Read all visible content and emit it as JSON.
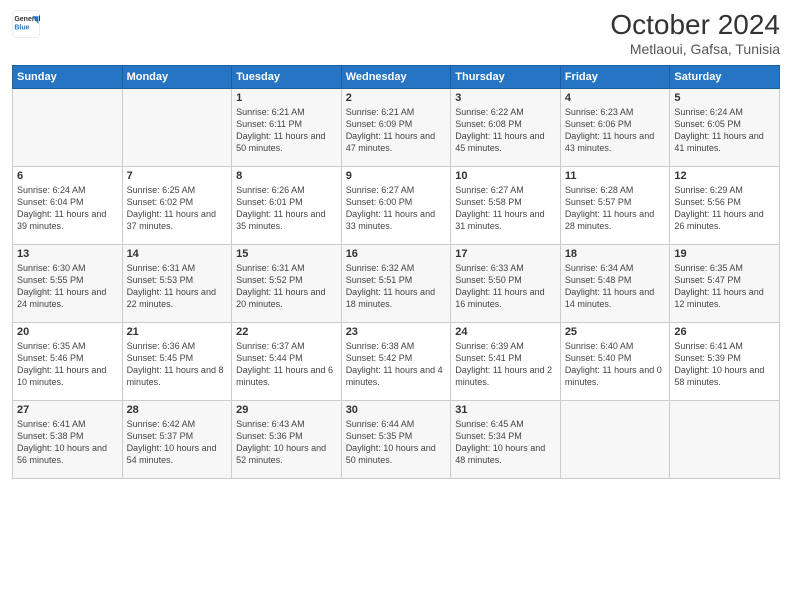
{
  "header": {
    "logo_line1": "General",
    "logo_line2": "Blue",
    "month": "October 2024",
    "location": "Metlaoui, Gafsa, Tunisia"
  },
  "days_of_week": [
    "Sunday",
    "Monday",
    "Tuesday",
    "Wednesday",
    "Thursday",
    "Friday",
    "Saturday"
  ],
  "weeks": [
    [
      {
        "day": "",
        "info": ""
      },
      {
        "day": "",
        "info": ""
      },
      {
        "day": "1",
        "info": "Sunrise: 6:21 AM\nSunset: 6:11 PM\nDaylight: 11 hours and 50 minutes."
      },
      {
        "day": "2",
        "info": "Sunrise: 6:21 AM\nSunset: 6:09 PM\nDaylight: 11 hours and 47 minutes."
      },
      {
        "day": "3",
        "info": "Sunrise: 6:22 AM\nSunset: 6:08 PM\nDaylight: 11 hours and 45 minutes."
      },
      {
        "day": "4",
        "info": "Sunrise: 6:23 AM\nSunset: 6:06 PM\nDaylight: 11 hours and 43 minutes."
      },
      {
        "day": "5",
        "info": "Sunrise: 6:24 AM\nSunset: 6:05 PM\nDaylight: 11 hours and 41 minutes."
      }
    ],
    [
      {
        "day": "6",
        "info": "Sunrise: 6:24 AM\nSunset: 6:04 PM\nDaylight: 11 hours and 39 minutes."
      },
      {
        "day": "7",
        "info": "Sunrise: 6:25 AM\nSunset: 6:02 PM\nDaylight: 11 hours and 37 minutes."
      },
      {
        "day": "8",
        "info": "Sunrise: 6:26 AM\nSunset: 6:01 PM\nDaylight: 11 hours and 35 minutes."
      },
      {
        "day": "9",
        "info": "Sunrise: 6:27 AM\nSunset: 6:00 PM\nDaylight: 11 hours and 33 minutes."
      },
      {
        "day": "10",
        "info": "Sunrise: 6:27 AM\nSunset: 5:58 PM\nDaylight: 11 hours and 31 minutes."
      },
      {
        "day": "11",
        "info": "Sunrise: 6:28 AM\nSunset: 5:57 PM\nDaylight: 11 hours and 28 minutes."
      },
      {
        "day": "12",
        "info": "Sunrise: 6:29 AM\nSunset: 5:56 PM\nDaylight: 11 hours and 26 minutes."
      }
    ],
    [
      {
        "day": "13",
        "info": "Sunrise: 6:30 AM\nSunset: 5:55 PM\nDaylight: 11 hours and 24 minutes."
      },
      {
        "day": "14",
        "info": "Sunrise: 6:31 AM\nSunset: 5:53 PM\nDaylight: 11 hours and 22 minutes."
      },
      {
        "day": "15",
        "info": "Sunrise: 6:31 AM\nSunset: 5:52 PM\nDaylight: 11 hours and 20 minutes."
      },
      {
        "day": "16",
        "info": "Sunrise: 6:32 AM\nSunset: 5:51 PM\nDaylight: 11 hours and 18 minutes."
      },
      {
        "day": "17",
        "info": "Sunrise: 6:33 AM\nSunset: 5:50 PM\nDaylight: 11 hours and 16 minutes."
      },
      {
        "day": "18",
        "info": "Sunrise: 6:34 AM\nSunset: 5:48 PM\nDaylight: 11 hours and 14 minutes."
      },
      {
        "day": "19",
        "info": "Sunrise: 6:35 AM\nSunset: 5:47 PM\nDaylight: 11 hours and 12 minutes."
      }
    ],
    [
      {
        "day": "20",
        "info": "Sunrise: 6:35 AM\nSunset: 5:46 PM\nDaylight: 11 hours and 10 minutes."
      },
      {
        "day": "21",
        "info": "Sunrise: 6:36 AM\nSunset: 5:45 PM\nDaylight: 11 hours and 8 minutes."
      },
      {
        "day": "22",
        "info": "Sunrise: 6:37 AM\nSunset: 5:44 PM\nDaylight: 11 hours and 6 minutes."
      },
      {
        "day": "23",
        "info": "Sunrise: 6:38 AM\nSunset: 5:42 PM\nDaylight: 11 hours and 4 minutes."
      },
      {
        "day": "24",
        "info": "Sunrise: 6:39 AM\nSunset: 5:41 PM\nDaylight: 11 hours and 2 minutes."
      },
      {
        "day": "25",
        "info": "Sunrise: 6:40 AM\nSunset: 5:40 PM\nDaylight: 11 hours and 0 minutes."
      },
      {
        "day": "26",
        "info": "Sunrise: 6:41 AM\nSunset: 5:39 PM\nDaylight: 10 hours and 58 minutes."
      }
    ],
    [
      {
        "day": "27",
        "info": "Sunrise: 6:41 AM\nSunset: 5:38 PM\nDaylight: 10 hours and 56 minutes."
      },
      {
        "day": "28",
        "info": "Sunrise: 6:42 AM\nSunset: 5:37 PM\nDaylight: 10 hours and 54 minutes."
      },
      {
        "day": "29",
        "info": "Sunrise: 6:43 AM\nSunset: 5:36 PM\nDaylight: 10 hours and 52 minutes."
      },
      {
        "day": "30",
        "info": "Sunrise: 6:44 AM\nSunset: 5:35 PM\nDaylight: 10 hours and 50 minutes."
      },
      {
        "day": "31",
        "info": "Sunrise: 6:45 AM\nSunset: 5:34 PM\nDaylight: 10 hours and 48 minutes."
      },
      {
        "day": "",
        "info": ""
      },
      {
        "day": "",
        "info": ""
      }
    ]
  ]
}
